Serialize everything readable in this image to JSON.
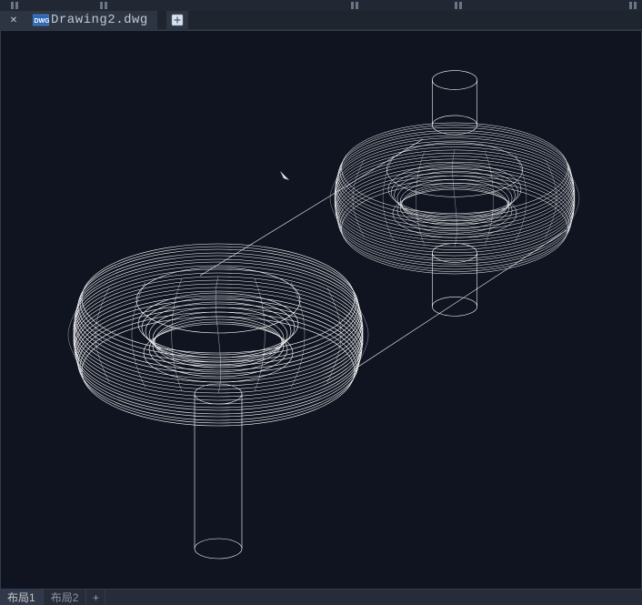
{
  "toolbar": {
    "close_tooltip": "Close",
    "new_tab_tooltip": "New Drawing"
  },
  "doc_tab": {
    "filename": "Drawing2.dwg",
    "icon": "dwg-file-icon"
  },
  "layout_tabs": {
    "tab1": "布局1",
    "tab2": "布局2",
    "add": "+"
  },
  "viewport": {
    "cursor_type": "crosshair-pick-cursor",
    "wireframe_color": "#ffffff",
    "background": "#0f1420"
  }
}
